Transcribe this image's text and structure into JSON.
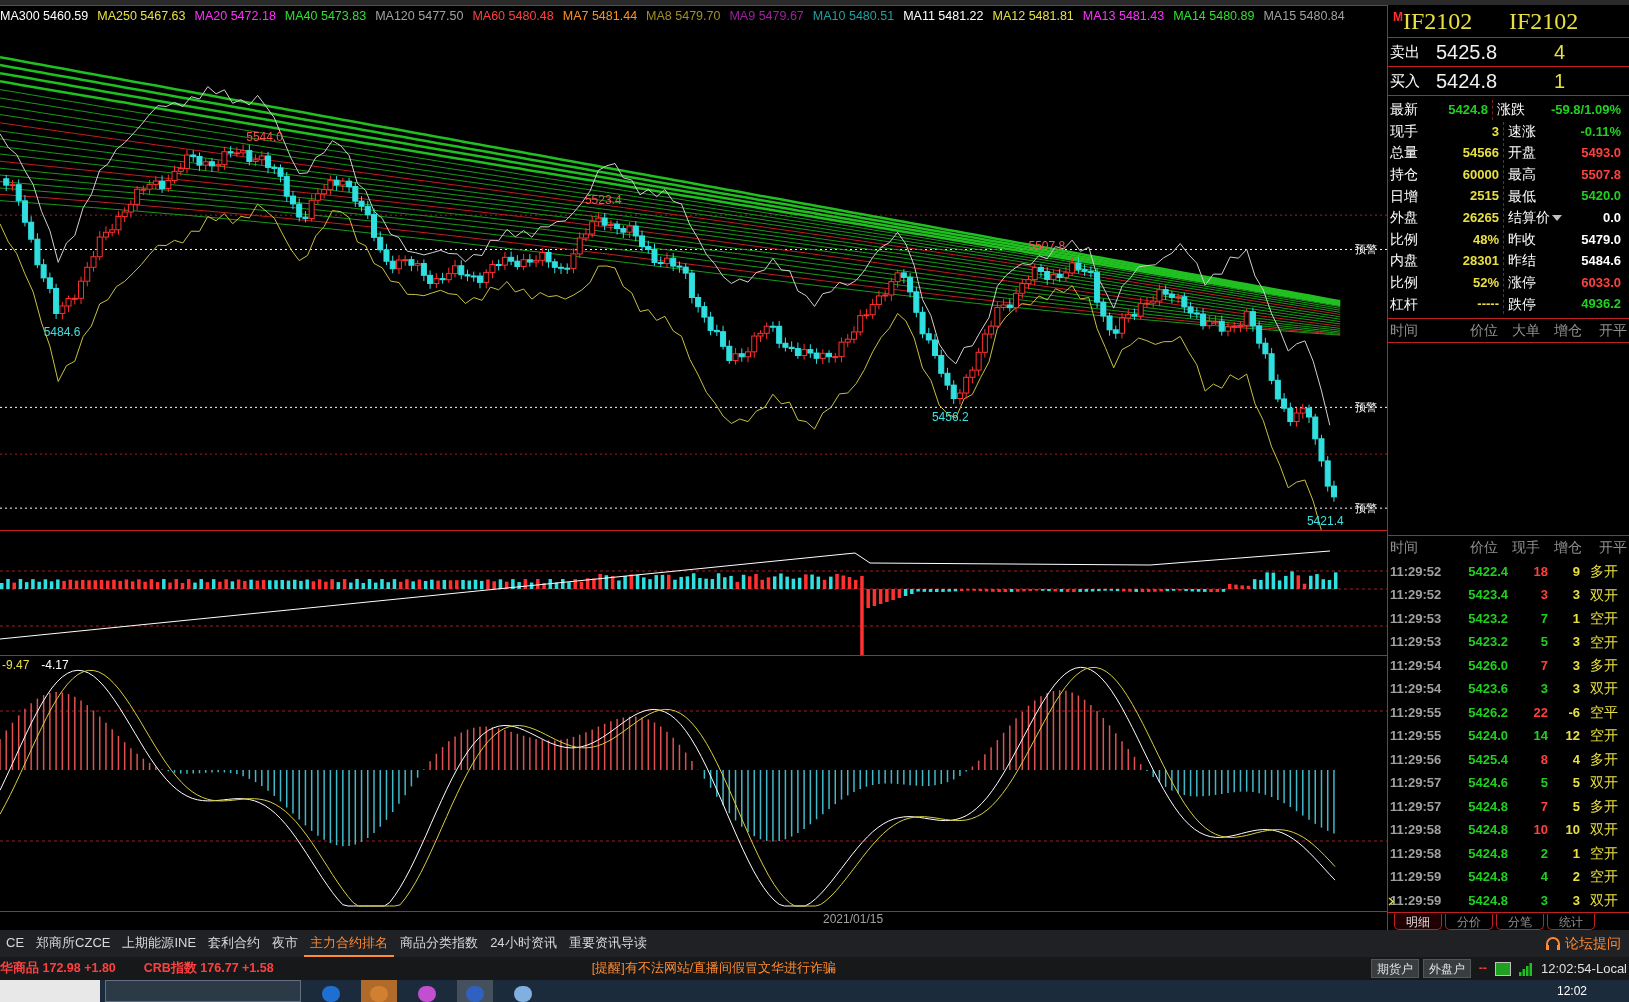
{
  "ma_legend": [
    {
      "label": "MA300",
      "value": "5460.59",
      "color": "#ffffff"
    },
    {
      "label": "MA250",
      "value": "5467.63",
      "color": "#e8e040"
    },
    {
      "label": "MA20",
      "value": "5472.18",
      "color": "#ff30ff"
    },
    {
      "label": "MA40",
      "value": "5473.83",
      "color": "#30e030"
    },
    {
      "label": "MA120",
      "value": "5477.50",
      "color": "#a0a0a0"
    },
    {
      "label": "MA60",
      "value": "5480.48",
      "color": "#ff4040"
    },
    {
      "label": "MA7",
      "value": "5481.44",
      "color": "#ff9020"
    },
    {
      "label": "MA8",
      "value": "5479.70",
      "color": "#a09020"
    },
    {
      "label": "MA9",
      "value": "5479.67",
      "color": "#a020a0"
    },
    {
      "label": "MA10",
      "value": "5480.51",
      "color": "#20a0a0"
    },
    {
      "label": "MA11",
      "value": "5481.22",
      "color": "#ffffff"
    },
    {
      "label": "MA12",
      "value": "5481.81",
      "color": "#e8e040"
    },
    {
      "label": "MA13",
      "value": "5481.43",
      "color": "#ff30ff"
    },
    {
      "label": "MA14",
      "value": "5480.89",
      "color": "#30e030"
    },
    {
      "label": "MA15",
      "value": "5480.84",
      "color": "#a0a0a0"
    }
  ],
  "price_chart": {
    "labels": [
      {
        "text": "5544.0",
        "kind": "high"
      },
      {
        "text": "5523.4",
        "kind": "high"
      },
      {
        "text": "5484.6",
        "kind": "low"
      },
      {
        "text": "5507.8",
        "kind": "high"
      },
      {
        "text": "5456.2",
        "kind": "low"
      },
      {
        "text": "5421.4",
        "kind": "low"
      }
    ],
    "alerts": [
      "预警",
      "预警",
      "预警"
    ]
  },
  "macd_legend": [
    {
      "text": "-9.47",
      "color": "#e8e040"
    },
    {
      "text": "-4.17",
      "color": "#ffffff"
    }
  ],
  "time_axis": [
    "2021/01/15"
  ],
  "quote": {
    "marker": "M",
    "code": "IF2102",
    "name": "IF2102",
    "orders": [
      {
        "label": "卖出",
        "price": "5425.8",
        "volume": "4"
      },
      {
        "label": "买入",
        "price": "5424.8",
        "volume": "1"
      }
    ],
    "stats": [
      [
        {
          "label": "最新",
          "value": "5424.8",
          "color": "#20d020",
          "kind": "plain"
        },
        {
          "label": "涨跌",
          "value": "-59.8/1.09%",
          "color": "#20d020",
          "kind": "plain"
        }
      ],
      [
        {
          "label": "现手",
          "value": "3",
          "color": "#e8e040",
          "kind": "plain"
        },
        {
          "label": "速涨",
          "value": "-0.11%",
          "color": "#20d020",
          "kind": "plain"
        }
      ],
      [
        {
          "label": "总量",
          "value": "54566",
          "color": "#e8e040",
          "kind": "plain"
        },
        {
          "label": "开盘",
          "value": "5493.0",
          "color": "#ff4040",
          "kind": "plain"
        }
      ],
      [
        {
          "label": "持仓",
          "value": "60000",
          "color": "#e8e040",
          "kind": "plain"
        },
        {
          "label": "最高",
          "value": "5507.8",
          "color": "#ff4040",
          "kind": "plain"
        }
      ],
      [
        {
          "label": "日增",
          "value": "2515",
          "color": "#e8e040",
          "kind": "plain"
        },
        {
          "label": "最低",
          "value": "5420.0",
          "color": "#20d020",
          "kind": "plain"
        }
      ],
      [
        {
          "label": "外盘",
          "value": "26265",
          "color": "#e8e040",
          "kind": "plain"
        },
        {
          "label": "结算价",
          "value": "0.0",
          "color": "#ffffff",
          "kind": "dropdown"
        }
      ],
      [
        {
          "label": "比例",
          "value": "48%",
          "color": "#e8e040",
          "kind": "plain"
        },
        {
          "label": "昨收",
          "value": "5479.0",
          "color": "#ffffff",
          "kind": "plain"
        }
      ],
      [
        {
          "label": "内盘",
          "value": "28301",
          "color": "#e8e040",
          "kind": "plain"
        },
        {
          "label": "昨结",
          "value": "5484.6",
          "color": "#ffffff",
          "kind": "plain"
        }
      ],
      [
        {
          "label": "比例",
          "value": "52%",
          "color": "#e8e040",
          "kind": "plain"
        },
        {
          "label": "涨停",
          "value": "6033.0",
          "color": "#ff4040",
          "kind": "plain"
        }
      ],
      [
        {
          "label": "杠杆",
          "value": "-----",
          "color": "#e8e040",
          "kind": "plain"
        },
        {
          "label": "跌停",
          "value": "4936.2",
          "color": "#20d020",
          "kind": "plain"
        }
      ]
    ]
  },
  "big_order_header": [
    "时间",
    "价位",
    "大单",
    "增仓",
    "开平"
  ],
  "trades": {
    "columns": [
      "时间",
      "价位",
      "现手",
      "增仓",
      "开平"
    ],
    "rows": [
      {
        "time": "11:29:52",
        "price": "5422.4",
        "volume": "18",
        "color": "#ff4040",
        "change": "9",
        "action": "多开",
        "selected": false
      },
      {
        "time": "11:29:52",
        "price": "5423.4",
        "volume": "3",
        "color": "#ff4040",
        "change": "3",
        "action": "双开",
        "selected": false
      },
      {
        "time": "11:29:53",
        "price": "5423.2",
        "volume": "7",
        "color": "#20d020",
        "change": "1",
        "action": "空开",
        "selected": false
      },
      {
        "time": "11:29:53",
        "price": "5423.2",
        "volume": "5",
        "color": "#20d020",
        "change": "3",
        "action": "空开",
        "selected": false
      },
      {
        "time": "11:29:54",
        "price": "5426.0",
        "volume": "7",
        "color": "#ff4040",
        "change": "3",
        "action": "多开",
        "selected": false
      },
      {
        "time": "11:29:54",
        "price": "5423.6",
        "volume": "3",
        "color": "#20d020",
        "change": "3",
        "action": "双开",
        "selected": false
      },
      {
        "time": "11:29:55",
        "price": "5426.2",
        "volume": "22",
        "color": "#ff4040",
        "change": "-6",
        "action": "空平",
        "selected": false
      },
      {
        "time": "11:29:55",
        "price": "5424.0",
        "volume": "14",
        "color": "#20d020",
        "change": "12",
        "action": "空开",
        "selected": false
      },
      {
        "time": "11:29:56",
        "price": "5425.4",
        "volume": "8",
        "color": "#ff4040",
        "change": "4",
        "action": "多开",
        "selected": false
      },
      {
        "time": "11:29:57",
        "price": "5424.6",
        "volume": "5",
        "color": "#20d020",
        "change": "5",
        "action": "双开",
        "selected": false
      },
      {
        "time": "11:29:57",
        "price": "5424.8",
        "volume": "7",
        "color": "#ff4040",
        "change": "5",
        "action": "多开",
        "selected": false
      },
      {
        "time": "11:29:58",
        "price": "5424.8",
        "volume": "10",
        "color": "#ff4040",
        "change": "10",
        "action": "双开",
        "selected": false
      },
      {
        "time": "11:29:58",
        "price": "5424.8",
        "volume": "2",
        "color": "#20d020",
        "change": "1",
        "action": "空开",
        "selected": false
      },
      {
        "time": "11:29:59",
        "price": "5424.8",
        "volume": "4",
        "color": "#20d020",
        "change": "2",
        "action": "空开",
        "selected": false
      },
      {
        "time": "11:29:59",
        "price": "5424.8",
        "volume": "3",
        "color": "#20d020",
        "change": "3",
        "action": "双开",
        "selected": true
      }
    ]
  },
  "panel_tabs": [
    {
      "label": "明细",
      "selected": true
    },
    {
      "label": "分价",
      "selected": false
    },
    {
      "label": "分笔",
      "selected": false
    },
    {
      "label": "统计",
      "selected": false
    }
  ],
  "market_tabs": [
    {
      "label": "CE",
      "selected": false
    },
    {
      "label": "郑商所CZCE",
      "selected": false
    },
    {
      "label": "上期能源INE",
      "selected": false
    },
    {
      "label": "套利合约",
      "selected": false
    },
    {
      "label": "夜市",
      "selected": false
    },
    {
      "label": "主力合约排名",
      "selected": true
    },
    {
      "label": "商品分类指数",
      "selected": false
    },
    {
      "label": "24小时资讯",
      "selected": false
    },
    {
      "label": "重要资讯导读",
      "selected": false
    }
  ],
  "forum_link": "论坛提问",
  "status_bar": {
    "indices": [
      {
        "name": "华商品",
        "value": "172.98",
        "change": "+1.80"
      },
      {
        "name": "CRB指数",
        "value": "176.77",
        "change": "+1.58"
      }
    ],
    "notice": "[提醒]有不法网站/直播间假冒文华进行诈骗",
    "buttons": [
      "期货户",
      "外盘户"
    ],
    "connection": "--",
    "clock": "12:02:54-Local"
  },
  "taskbar": {
    "clock": "12:02"
  }
}
